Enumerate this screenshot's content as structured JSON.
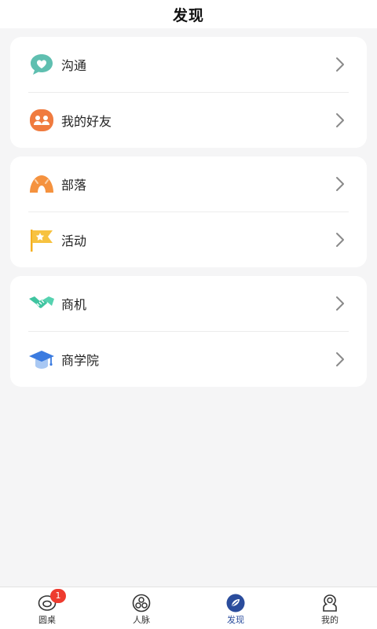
{
  "header": {
    "title": "发现"
  },
  "groups": [
    {
      "items": [
        {
          "label": "沟通",
          "icon": "chat-heart-icon"
        },
        {
          "label": "我的好友",
          "icon": "friends-icon"
        }
      ]
    },
    {
      "items": [
        {
          "label": "部落",
          "icon": "tent-icon"
        },
        {
          "label": "活动",
          "icon": "flag-star-icon"
        }
      ]
    },
    {
      "items": [
        {
          "label": "商机",
          "icon": "handshake-icon"
        },
        {
          "label": "商学院",
          "icon": "graduation-cap-icon"
        }
      ]
    }
  ],
  "tabbar": {
    "tabs": [
      {
        "label": "圆桌",
        "icon": "round-table-icon",
        "badge": "1"
      },
      {
        "label": "人脉",
        "icon": "network-icon"
      },
      {
        "label": "发现",
        "icon": "discover-leaf-icon",
        "active": true
      },
      {
        "label": "我的",
        "icon": "profile-icon"
      }
    ]
  },
  "colors": {
    "accent": "#2a4c9c",
    "badge": "#ee3b2f",
    "chat_icon": "#5fbfb0",
    "friends_icon": "#f07b3f",
    "tent_icon": "#f5923e",
    "flag_icon": "#f7c240",
    "handshake_icon": "#3fc4a0",
    "cap_icon": "#3b7be0"
  }
}
